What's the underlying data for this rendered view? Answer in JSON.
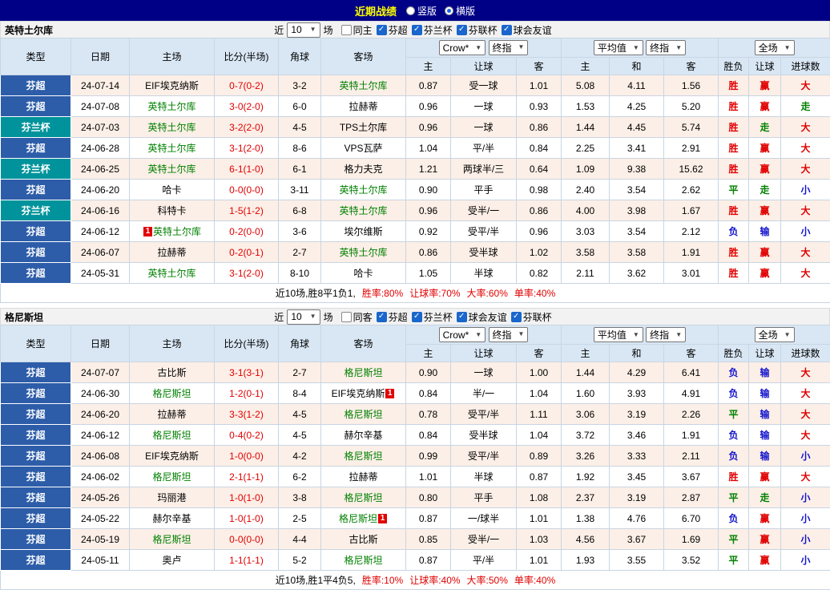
{
  "colors": {
    "win": "#e10000",
    "draw": "#008000",
    "loss": "#1414cc",
    "score": "#e10000",
    "team_self": "#008000",
    "league_bg": "#2d5da9",
    "cup_bg": "#00939b",
    "badge_bg": "#e10000",
    "topbar_bg": "#000086",
    "header_bg": "#d9e7f5",
    "alt_row_bg": "#fcefe7"
  },
  "topbar": {
    "title": "近期战绩",
    "radios": [
      {
        "label": "竖版",
        "selected": false
      },
      {
        "label": "横版",
        "selected": true
      }
    ]
  },
  "filter_labels": {
    "near": "近",
    "count": "10",
    "games": "场"
  },
  "columns": {
    "type": "类型",
    "date": "日期",
    "home": "主场",
    "score": "比分(半场)",
    "corner": "角球",
    "away": "客场",
    "odds_dd1": "Crow*",
    "odds_dd2": "终指",
    "avg_dd1": "平均值",
    "avg_dd2": "终指",
    "full_dd": "全场",
    "odds_home": "主",
    "odds_hc": "让球",
    "odds_away": "客",
    "avg_home": "主",
    "avg_draw": "和",
    "avg_away": "客",
    "result": "胜负",
    "hc_result": "让球",
    "goals": "进球数"
  },
  "sections": [
    {
      "team": "英特土尔库",
      "checkboxes": [
        {
          "label": "同主",
          "checked": false
        },
        {
          "label": "芬超",
          "checked": true
        },
        {
          "label": "芬兰杯",
          "checked": true
        },
        {
          "label": "芬联杯",
          "checked": true
        },
        {
          "label": "球会友谊",
          "checked": true
        }
      ],
      "rows": [
        {
          "type": "芬超",
          "date": "24-07-14",
          "home": "EIF埃克纳斯",
          "home_self": false,
          "score": "0-7(0-2)",
          "corner": "3-2",
          "away": "英特土尔库",
          "away_self": true,
          "odds": [
            "0.87",
            "受一球",
            "1.01"
          ],
          "avg": [
            "5.08",
            "4.11",
            "1.56"
          ],
          "result": "胜",
          "hc_result": "赢",
          "goals": "大"
        },
        {
          "type": "芬超",
          "date": "24-07-08",
          "home": "英特土尔库",
          "home_self": true,
          "score": "3-0(2-0)",
          "corner": "6-0",
          "away": "拉赫蒂",
          "away_self": false,
          "odds": [
            "0.96",
            "一球",
            "0.93"
          ],
          "avg": [
            "1.53",
            "4.25",
            "5.20"
          ],
          "result": "胜",
          "hc_result": "赢",
          "goals": "走"
        },
        {
          "type": "芬兰杯",
          "date": "24-07-03",
          "home": "英特土尔库",
          "home_self": true,
          "score": "3-2(2-0)",
          "corner": "4-5",
          "away": "TPS土尔库",
          "away_self": false,
          "odds": [
            "0.96",
            "一球",
            "0.86"
          ],
          "avg": [
            "1.44",
            "4.45",
            "5.74"
          ],
          "result": "胜",
          "hc_result": "走",
          "goals": "大"
        },
        {
          "type": "芬超",
          "date": "24-06-28",
          "home": "英特土尔库",
          "home_self": true,
          "score": "3-1(2-0)",
          "corner": "8-6",
          "away": "VPS瓦萨",
          "away_self": false,
          "odds": [
            "1.04",
            "平/半",
            "0.84"
          ],
          "avg": [
            "2.25",
            "3.41",
            "2.91"
          ],
          "result": "胜",
          "hc_result": "赢",
          "goals": "大"
        },
        {
          "type": "芬兰杯",
          "date": "24-06-25",
          "home": "英特土尔库",
          "home_self": true,
          "score": "6-1(1-0)",
          "corner": "6-1",
          "away": "格力夫克",
          "away_self": false,
          "odds": [
            "1.21",
            "两球半/三",
            "0.64"
          ],
          "avg": [
            "1.09",
            "9.38",
            "15.62"
          ],
          "result": "胜",
          "hc_result": "赢",
          "goals": "大"
        },
        {
          "type": "芬超",
          "date": "24-06-20",
          "home": "哈卡",
          "home_self": false,
          "score": "0-0(0-0)",
          "corner": "3-11",
          "away": "英特土尔库",
          "away_self": true,
          "odds": [
            "0.90",
            "平手",
            "0.98"
          ],
          "avg": [
            "2.40",
            "3.54",
            "2.62"
          ],
          "result": "平",
          "hc_result": "走",
          "goals": "小"
        },
        {
          "type": "芬兰杯",
          "date": "24-06-16",
          "home": "科特卡",
          "home_self": false,
          "score": "1-5(1-2)",
          "corner": "6-8",
          "away": "英特土尔库",
          "away_self": true,
          "odds": [
            "0.96",
            "受半/一",
            "0.86"
          ],
          "avg": [
            "4.00",
            "3.98",
            "1.67"
          ],
          "result": "胜",
          "hc_result": "赢",
          "goals": "大"
        },
        {
          "type": "芬超",
          "date": "24-06-12",
          "home": "英特土尔库",
          "home_self": true,
          "home_badge": "1",
          "home_badge_pos": "before",
          "score": "0-2(0-0)",
          "corner": "3-6",
          "away": "埃尔维斯",
          "away_self": false,
          "odds": [
            "0.92",
            "受平/半",
            "0.96"
          ],
          "avg": [
            "3.03",
            "3.54",
            "2.12"
          ],
          "result": "负",
          "hc_result": "输",
          "goals": "小"
        },
        {
          "type": "芬超",
          "date": "24-06-07",
          "home": "拉赫蒂",
          "home_self": false,
          "score": "0-2(0-1)",
          "corner": "2-7",
          "away": "英特土尔库",
          "away_self": true,
          "odds": [
            "0.86",
            "受半球",
            "1.02"
          ],
          "avg": [
            "3.58",
            "3.58",
            "1.91"
          ],
          "result": "胜",
          "hc_result": "赢",
          "goals": "大"
        },
        {
          "type": "芬超",
          "date": "24-05-31",
          "home": "英特土尔库",
          "home_self": true,
          "score": "3-1(2-0)",
          "corner": "8-10",
          "away": "哈卡",
          "away_self": false,
          "odds": [
            "1.05",
            "半球",
            "0.82"
          ],
          "avg": [
            "2.11",
            "3.62",
            "3.01"
          ],
          "result": "胜",
          "hc_result": "赢",
          "goals": "大"
        }
      ],
      "footer": {
        "prefix": "近10场,胜8平1负1,",
        "stats": [
          "胜率:80%",
          "让球率:70%",
          "大率:60%",
          "单率:40%"
        ]
      }
    },
    {
      "team": "格尼斯坦",
      "checkboxes": [
        {
          "label": "同客",
          "checked": false
        },
        {
          "label": "芬超",
          "checked": true
        },
        {
          "label": "芬兰杯",
          "checked": true
        },
        {
          "label": "球会友谊",
          "checked": true
        },
        {
          "label": "芬联杯",
          "checked": true
        }
      ],
      "rows": [
        {
          "type": "芬超",
          "date": "24-07-07",
          "home": "古比斯",
          "home_self": false,
          "score": "3-1(3-1)",
          "corner": "2-7",
          "away": "格尼斯坦",
          "away_self": true,
          "odds": [
            "0.90",
            "一球",
            "1.00"
          ],
          "avg": [
            "1.44",
            "4.29",
            "6.41"
          ],
          "result": "负",
          "hc_result": "输",
          "goals": "大"
        },
        {
          "type": "芬超",
          "date": "24-06-30",
          "home": "格尼斯坦",
          "home_self": true,
          "score": "1-2(0-1)",
          "corner": "8-4",
          "away": "EIF埃克纳斯",
          "away_self": false,
          "away_badge": "1",
          "away_badge_pos": "after",
          "odds": [
            "0.84",
            "半/一",
            "1.04"
          ],
          "avg": [
            "1.60",
            "3.93",
            "4.91"
          ],
          "result": "负",
          "hc_result": "输",
          "goals": "大"
        },
        {
          "type": "芬超",
          "date": "24-06-20",
          "home": "拉赫蒂",
          "home_self": false,
          "score": "3-3(1-2)",
          "corner": "4-5",
          "away": "格尼斯坦",
          "away_self": true,
          "odds": [
            "0.78",
            "受平/半",
            "1.11"
          ],
          "avg": [
            "3.06",
            "3.19",
            "2.26"
          ],
          "result": "平",
          "hc_result": "输",
          "goals": "大"
        },
        {
          "type": "芬超",
          "date": "24-06-12",
          "home": "格尼斯坦",
          "home_self": true,
          "score": "0-4(0-2)",
          "corner": "4-5",
          "away": "赫尔辛基",
          "away_self": false,
          "odds": [
            "0.84",
            "受半球",
            "1.04"
          ],
          "avg": [
            "3.72",
            "3.46",
            "1.91"
          ],
          "result": "负",
          "hc_result": "输",
          "goals": "大"
        },
        {
          "type": "芬超",
          "date": "24-06-08",
          "home": "EIF埃克纳斯",
          "home_self": false,
          "score": "1-0(0-0)",
          "corner": "4-2",
          "away": "格尼斯坦",
          "away_self": true,
          "odds": [
            "0.99",
            "受平/半",
            "0.89"
          ],
          "avg": [
            "3.26",
            "3.33",
            "2.11"
          ],
          "result": "负",
          "hc_result": "输",
          "goals": "小"
        },
        {
          "type": "芬超",
          "date": "24-06-02",
          "home": "格尼斯坦",
          "home_self": true,
          "score": "2-1(1-1)",
          "corner": "6-2",
          "away": "拉赫蒂",
          "away_self": false,
          "odds": [
            "1.01",
            "半球",
            "0.87"
          ],
          "avg": [
            "1.92",
            "3.45",
            "3.67"
          ],
          "result": "胜",
          "hc_result": "赢",
          "goals": "大"
        },
        {
          "type": "芬超",
          "date": "24-05-26",
          "home": "玛丽港",
          "home_self": false,
          "score": "1-0(1-0)",
          "corner": "3-8",
          "away": "格尼斯坦",
          "away_self": true,
          "odds": [
            "0.80",
            "平手",
            "1.08"
          ],
          "avg": [
            "2.37",
            "3.19",
            "2.87"
          ],
          "result": "平",
          "hc_result": "走",
          "goals": "小"
        },
        {
          "type": "芬超",
          "date": "24-05-22",
          "home": "赫尔辛基",
          "home_self": false,
          "score": "1-0(1-0)",
          "corner": "2-5",
          "away": "格尼斯坦",
          "away_self": true,
          "away_badge": "1",
          "away_badge_pos": "after",
          "odds": [
            "0.87",
            "一/球半",
            "1.01"
          ],
          "avg": [
            "1.38",
            "4.76",
            "6.70"
          ],
          "result": "负",
          "hc_result": "赢",
          "goals": "小"
        },
        {
          "type": "芬超",
          "date": "24-05-19",
          "home": "格尼斯坦",
          "home_self": true,
          "score": "0-0(0-0)",
          "corner": "4-4",
          "away": "古比斯",
          "away_self": false,
          "odds": [
            "0.85",
            "受半/一",
            "1.03"
          ],
          "avg": [
            "4.56",
            "3.67",
            "1.69"
          ],
          "result": "平",
          "hc_result": "赢",
          "goals": "小"
        },
        {
          "type": "芬超",
          "date": "24-05-11",
          "home": "奥卢",
          "home_self": false,
          "score": "1-1(1-1)",
          "corner": "5-2",
          "away": "格尼斯坦",
          "away_self": true,
          "odds": [
            "0.87",
            "平/半",
            "1.01"
          ],
          "avg": [
            "1.93",
            "3.55",
            "3.52"
          ],
          "result": "平",
          "hc_result": "赢",
          "goals": "小"
        }
      ],
      "footer": {
        "prefix": "近10场,胜1平4负5,",
        "stats": [
          "胜率:10%",
          "让球率:40%",
          "大率:50%",
          "单率:40%"
        ]
      }
    }
  ]
}
